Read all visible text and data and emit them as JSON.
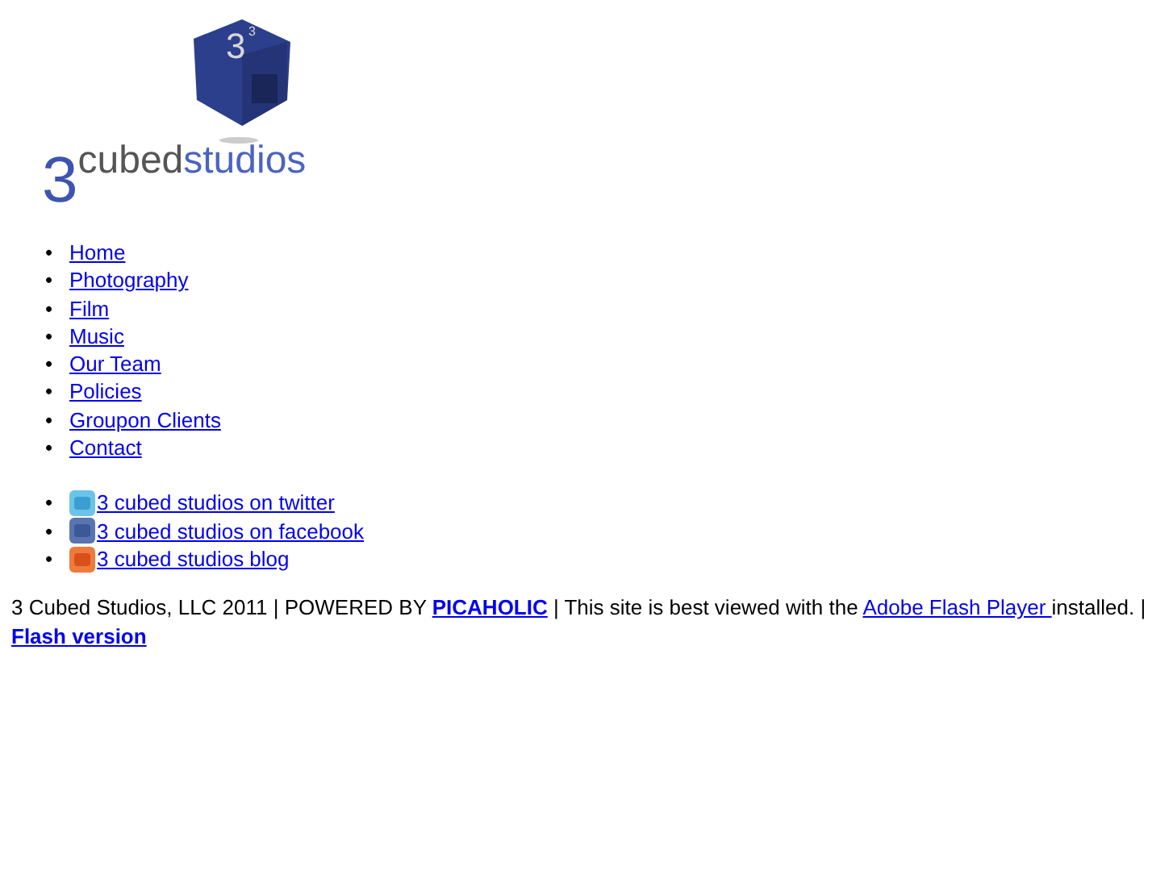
{
  "logo": {
    "cube_digit": "3",
    "cube_exponent": "3",
    "numeral": "3",
    "word_1": "cubed",
    "word_2": "studios"
  },
  "nav": [
    {
      "bullet": "•",
      "label": "Home"
    },
    {
      "bullet": "•",
      "label": "Photography"
    },
    {
      "bullet": "•",
      "label": "Film"
    },
    {
      "bullet": "•",
      "label": "Music"
    },
    {
      "bullet": "•",
      "label": "Our Team"
    },
    {
      "bullet": "•",
      "label": "Policies"
    },
    {
      "bullet": "•",
      "label": "Groupon Clients"
    },
    {
      "bullet": "•",
      "label": "Contact"
    }
  ],
  "social": [
    {
      "bullet": "•",
      "kind": "twitter",
      "label": "3 cubed studios on twitter"
    },
    {
      "bullet": "•",
      "kind": "facebook",
      "label": "3 cubed studios on facebook"
    },
    {
      "bullet": "•",
      "kind": "blog",
      "label": "3 cubed studios blog"
    }
  ],
  "footer": {
    "text_1": "3 Cubed Studios, LLC 2011 | POWERED BY",
    "link_1": "PICAHOLIC",
    "text_2": "| This site is best viewed with the",
    "link_2": "Adobe Flash Player ",
    "text_3": "installed. |",
    "link_3": "Flash version"
  }
}
